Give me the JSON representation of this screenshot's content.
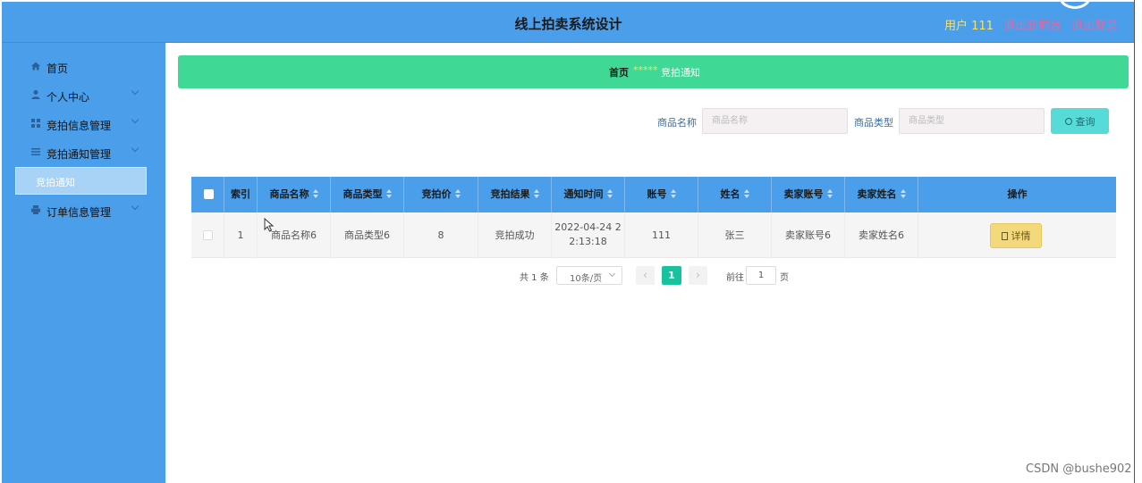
{
  "header": {
    "title": "线上拍卖系统设计",
    "user": "用户 111",
    "back_label": "退出到前台",
    "logout_label": "退出登录"
  },
  "sidebar": {
    "items": [
      {
        "label": "首页",
        "icon": "home-icon"
      },
      {
        "label": "个人中心",
        "icon": "person-icon"
      },
      {
        "label": "竞拍信息管理",
        "icon": "grid-icon"
      },
      {
        "label": "竞拍通知管理",
        "icon": "list-icon"
      },
      {
        "label": "订单信息管理",
        "icon": "printer-icon"
      }
    ],
    "submenu_active": "竞拍通知"
  },
  "breadcrumb": {
    "home": "首页",
    "separator": "*****",
    "current": "竞拍通知"
  },
  "filters": {
    "name_label": "商品名称",
    "name_placeholder": "商品名称",
    "type_label": "商品类型",
    "type_placeholder": "商品类型",
    "query_label": "查询"
  },
  "table": {
    "columns": [
      "索引",
      "商品名称",
      "商品类型",
      "竞拍价",
      "竞拍结果",
      "通知时间",
      "账号",
      "姓名",
      "卖家账号",
      "卖家姓名",
      "操作"
    ],
    "rows": [
      {
        "index": "1",
        "name": "商品名称6",
        "type": "商品类型6",
        "price": "8",
        "result": "竞拍成功",
        "time_line1": "2022-04-24 2",
        "time_line2": "2:13:18",
        "account": "111",
        "person": "张三",
        "seller_account": "卖家账号6",
        "seller_name": "卖家姓名6",
        "action": "详情"
      }
    ]
  },
  "pagination": {
    "total": "共 1 条",
    "page_size": "10条/页",
    "prev": "‹",
    "current": "1",
    "next": "›",
    "goto_label": "前往",
    "goto_value": "1",
    "page_suffix": "页"
  },
  "watermark": "CSDN @bushe902",
  "colors": {
    "header_bg": "#4a9eea",
    "breadcrumb_bg": "#3fd895",
    "query_bg": "#56dbd9",
    "detail_bg": "#f3d97c",
    "page_active": "#19c29f"
  }
}
